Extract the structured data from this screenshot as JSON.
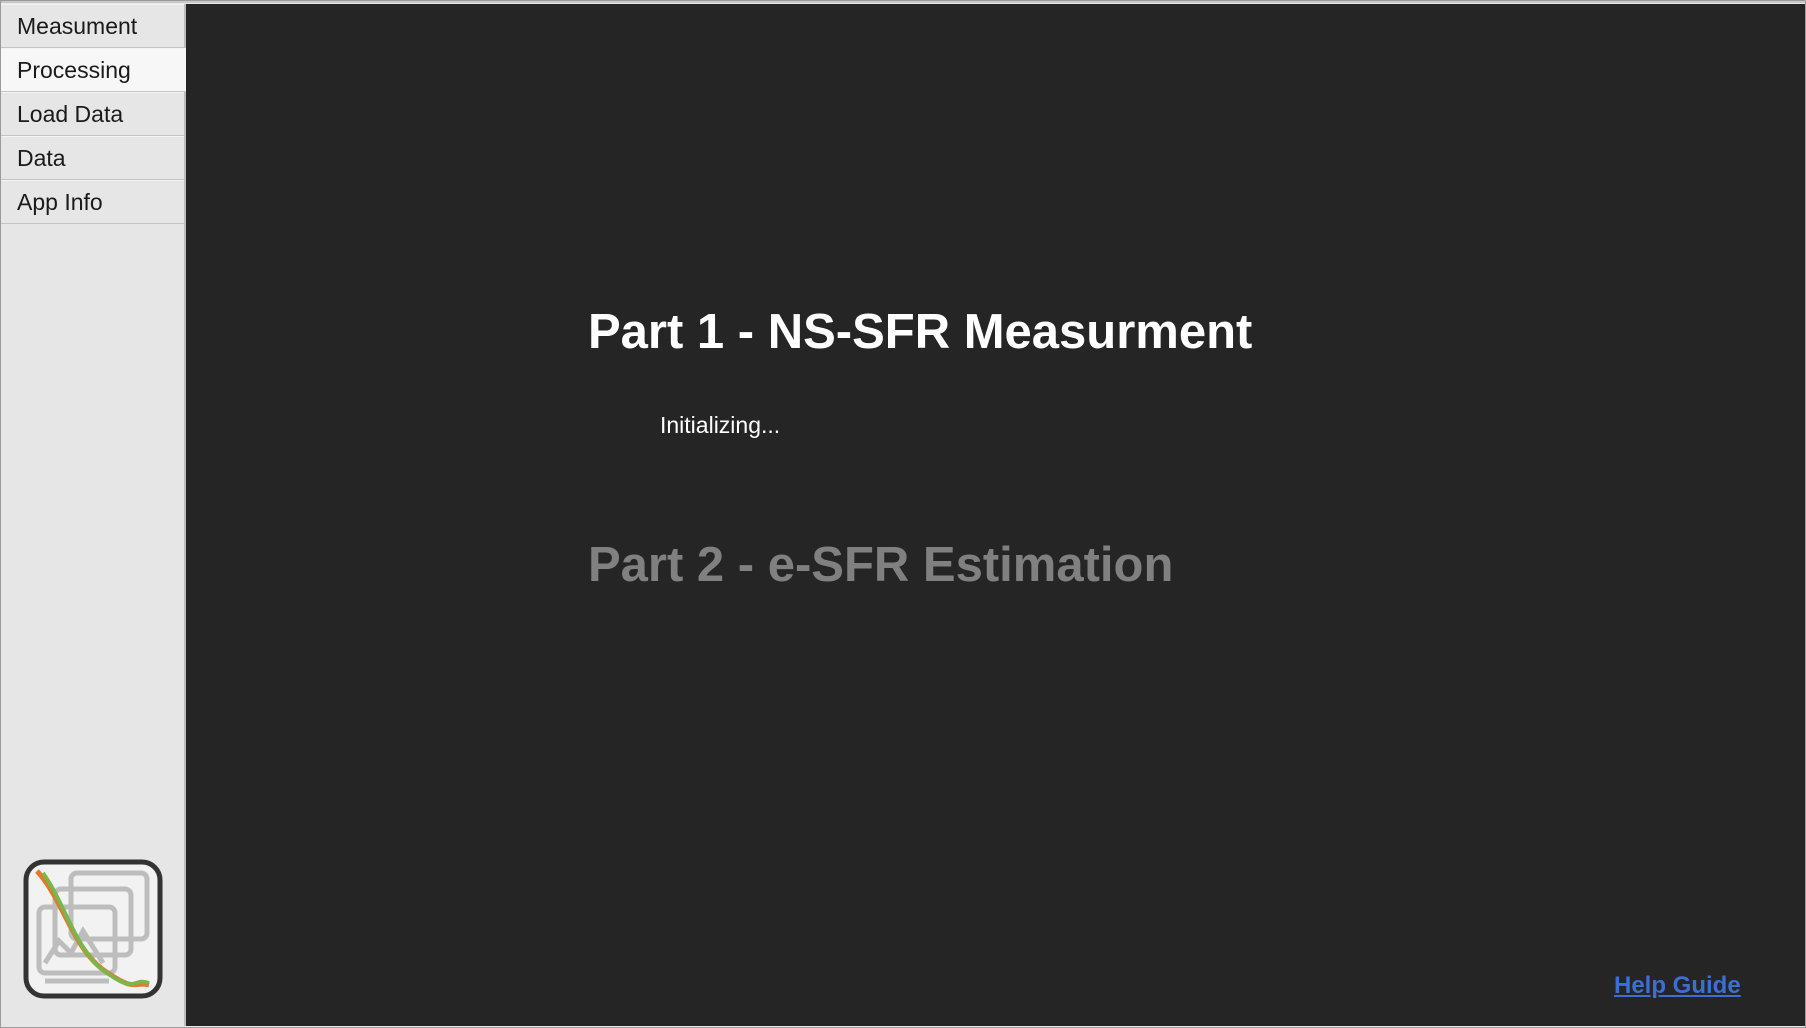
{
  "sidebar": {
    "tabs": [
      {
        "label": "Measument",
        "active": false
      },
      {
        "label": "Processing",
        "active": true
      },
      {
        "label": "Load Data",
        "active": false
      },
      {
        "label": "Data",
        "active": false
      },
      {
        "label": "App Info",
        "active": false
      }
    ]
  },
  "main": {
    "part1_title": "Part 1 - NS-SFR Measurment",
    "status_text": "Initializing...",
    "part2_title": "Part 2 - e-SFR Estimation",
    "help_link": "Help Guide"
  },
  "colors": {
    "main_background": "#252525",
    "sidebar_background": "#e6e6e6",
    "part1_color": "#ffffff",
    "part2_color": "#808080",
    "link_color": "#3b6fd6",
    "logo_curve_orange": "#e07a30",
    "logo_curve_green": "#7ab648"
  },
  "icons": {
    "logo": "app-logo-icon"
  }
}
